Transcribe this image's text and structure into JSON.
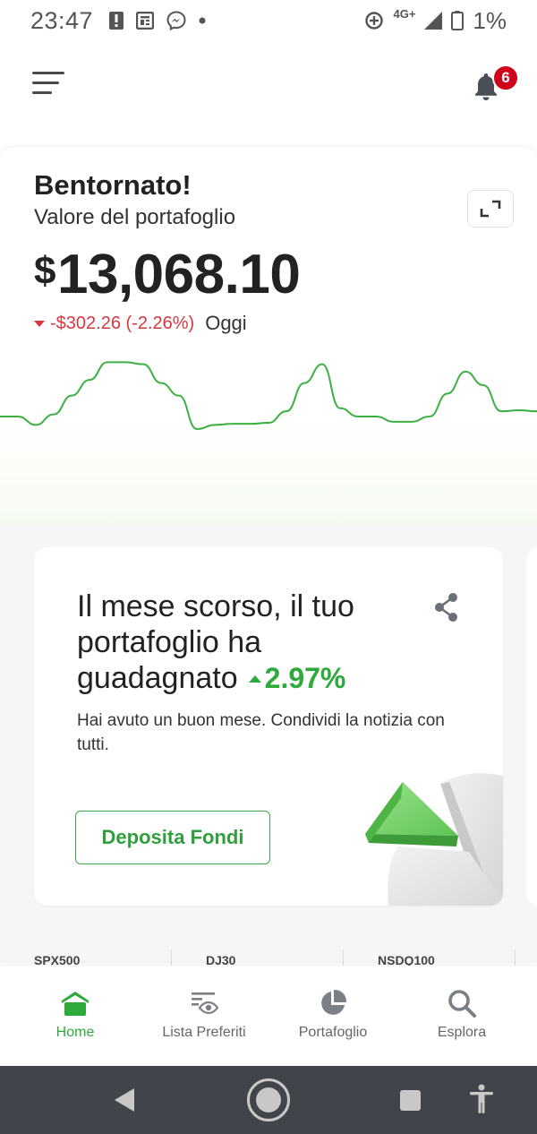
{
  "status_bar": {
    "time": "23:47",
    "network": "4G+",
    "battery": "1%"
  },
  "header": {
    "notification_count": "6"
  },
  "portfolio": {
    "greeting": "Bentornato!",
    "subtitle": "Valore del portafoglio",
    "currency": "$",
    "value": "13,068.10",
    "change": "-$302.26 (-2.26%)",
    "period": "Oggi",
    "chart_data": {
      "type": "line",
      "values": [
        60,
        60,
        52,
        62,
        80,
        95,
        112,
        112,
        110,
        92,
        80,
        48,
        52,
        53,
        53,
        54,
        65,
        92,
        110,
        68,
        60,
        60,
        55,
        55,
        60,
        82,
        103,
        90,
        65,
        66,
        65
      ],
      "color": "#3cb043"
    }
  },
  "insight_card": {
    "headline": "Il mese scorso, il tuo portafoglio ha guadagnato",
    "percent": "2.97%",
    "body": "Hai avuto un buon mese. Condividi la notizia con tutti.",
    "cta_label": "Deposita Fondi"
  },
  "tickers": [
    "SPX500",
    "DJ30",
    "NSDQ100"
  ],
  "tabs": [
    {
      "label": "Home",
      "icon": "home-icon",
      "active": true
    },
    {
      "label": "Lista Preferiti",
      "icon": "watchlist-icon",
      "active": false
    },
    {
      "label": "Portafoglio",
      "icon": "pie-chart-icon",
      "active": false
    },
    {
      "label": "Esplora",
      "icon": "search-icon",
      "active": false
    }
  ],
  "colors": {
    "accent": "#2eaa3c",
    "negative": "#d9363e",
    "badge": "#d0021b"
  }
}
